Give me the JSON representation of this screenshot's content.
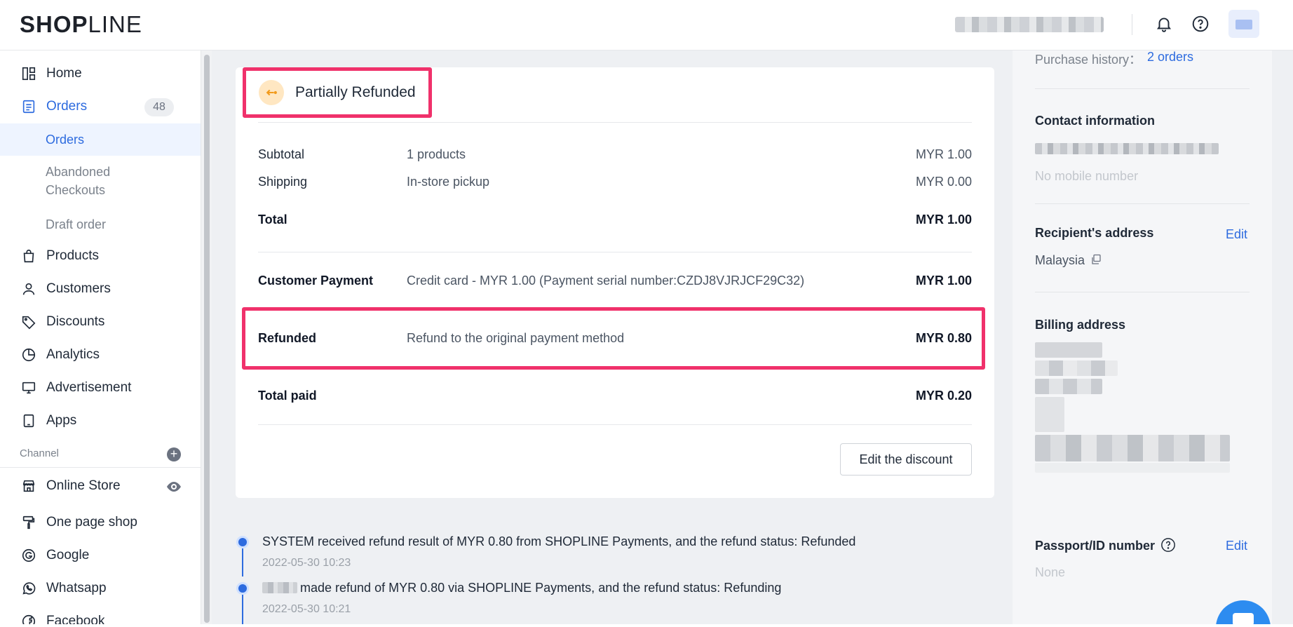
{
  "brand": {
    "logo_bold": "SHOP",
    "logo_light": "LINE"
  },
  "sidebar": {
    "items": [
      {
        "label": "Home",
        "icon": "dashboard-icon"
      },
      {
        "label": "Orders",
        "icon": "orders-icon",
        "badge": "48"
      },
      {
        "label": "Products",
        "icon": "bag-icon"
      },
      {
        "label": "Customers",
        "icon": "person-icon"
      },
      {
        "label": "Discounts",
        "icon": "tag-icon"
      },
      {
        "label": "Analytics",
        "icon": "pie-chart-icon"
      },
      {
        "label": "Advertisement",
        "icon": "monitor-icon"
      },
      {
        "label": "Apps",
        "icon": "tablet-icon"
      }
    ],
    "order_subitems": [
      {
        "label": "Orders"
      },
      {
        "label": "Abandoned Checkouts"
      },
      {
        "label": "Draft order"
      }
    ],
    "channel_label": "Channel",
    "channels": [
      {
        "label": "Online Store",
        "icon": "store-icon"
      },
      {
        "label": "One page shop",
        "icon": "paint-roller-icon"
      },
      {
        "label": "Google",
        "icon": "google-icon"
      },
      {
        "label": "Whatsapp",
        "icon": "whatsapp-icon"
      },
      {
        "label": "Facebook",
        "icon": "facebook-icon"
      }
    ]
  },
  "order": {
    "status": "Partially Refunded",
    "rows": {
      "subtotal": {
        "label": "Subtotal",
        "desc": "1 products",
        "amount": "MYR 1.00"
      },
      "shipping": {
        "label": "Shipping",
        "desc": "In-store pickup",
        "amount": "MYR 0.00"
      },
      "total": {
        "label": "Total",
        "amount": "MYR 1.00"
      },
      "payment": {
        "label": "Customer Payment",
        "desc": "Credit card - MYR 1.00 (Payment serial number:CZDJ8VJRJCF29C32)",
        "amount": "MYR 1.00"
      },
      "refunded": {
        "label": "Refunded",
        "desc": "Refund to the original payment method",
        "amount": "MYR 0.80"
      },
      "total_paid": {
        "label": "Total paid",
        "amount": "MYR 0.20"
      }
    },
    "edit_discount_label": "Edit the discount"
  },
  "timeline": [
    {
      "text": "SYSTEM received refund result of MYR 0.80 from SHOPLINE Payments, and the refund status: Refunded",
      "time": "2022-05-30 10:23"
    },
    {
      "text": "made refund of MYR 0.80 via SHOPLINE Payments, and the refund status: Refunding",
      "time": "2022-05-30 10:21"
    }
  ],
  "customer_panel": {
    "purchase_history_label": "Purchase history：",
    "purchase_history_link": "2 orders",
    "contact_title": "Contact information",
    "no_mobile": "No mobile number",
    "recipient_title": "Recipient's address",
    "recipient_edit": "Edit",
    "recipient_country": "Malaysia",
    "billing_title": "Billing address",
    "passport_title": "Passport/ID number",
    "passport_edit": "Edit",
    "passport_value": "None"
  },
  "colors": {
    "accent": "#2d6bdf",
    "highlight": "#f0316b",
    "status_icon_bg": "#ffe7c2"
  }
}
